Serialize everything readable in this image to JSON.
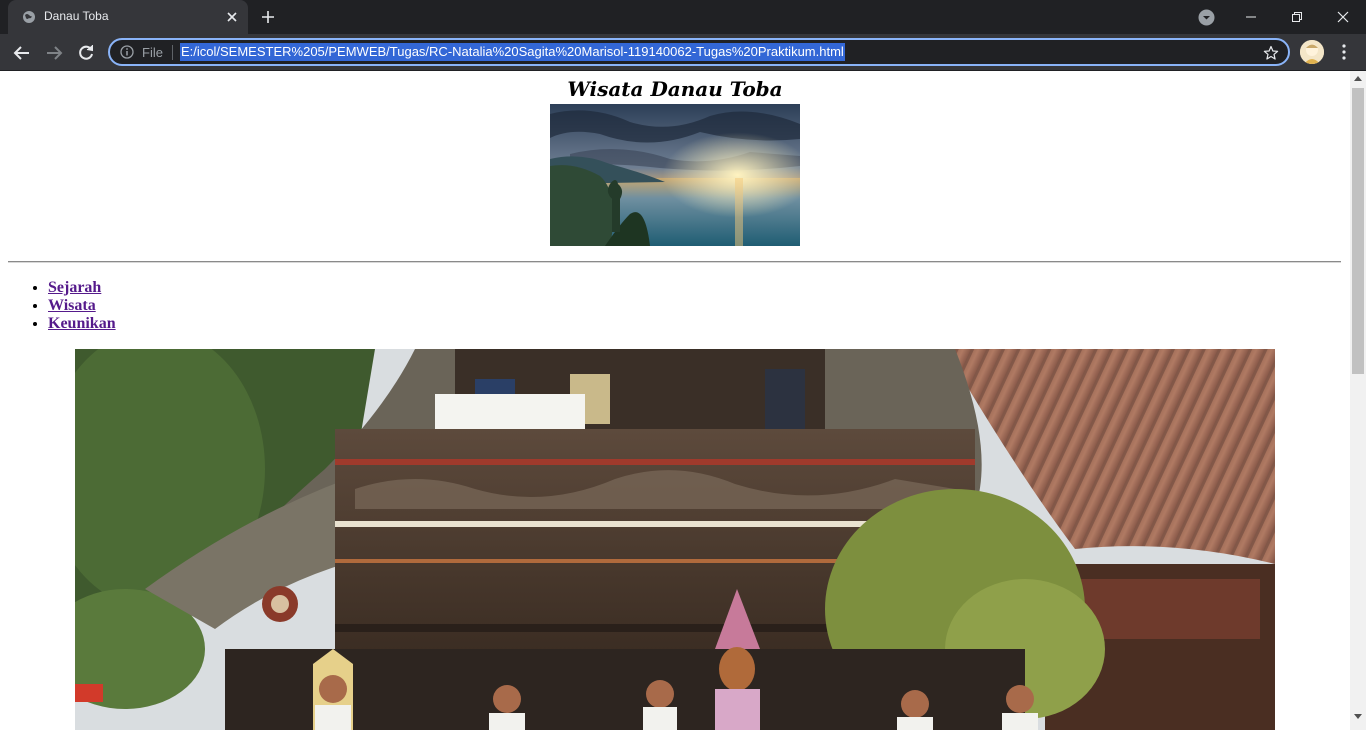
{
  "browser": {
    "tab_title": "Danau Toba",
    "omnibox_scheme_label": "File",
    "url": "E:/icol/SEMESTER%205/PEMWEB/Tugas/RC-Natalia%20Sagita%20Marisol-119140062-Tugas%20Praktikum.html",
    "accent_color": "#8ab4f8",
    "selection_color": "#3367d6"
  },
  "page": {
    "title": "Wisata Danau Toba",
    "nav_links": [
      "Sejarah",
      "Wisata",
      "Keunikan"
    ],
    "link_color": "#551a8b"
  },
  "icons": {
    "tab_favicon": "globe-icon",
    "tab_close": "close-icon",
    "new_tab": "plus-icon",
    "tab_search": "tab-search-icon",
    "back": "arrow-left-icon",
    "forward": "arrow-right-icon",
    "reload": "reload-icon",
    "site_info": "info-icon",
    "bookmark": "star-icon",
    "menu": "kebab-menu-icon"
  }
}
